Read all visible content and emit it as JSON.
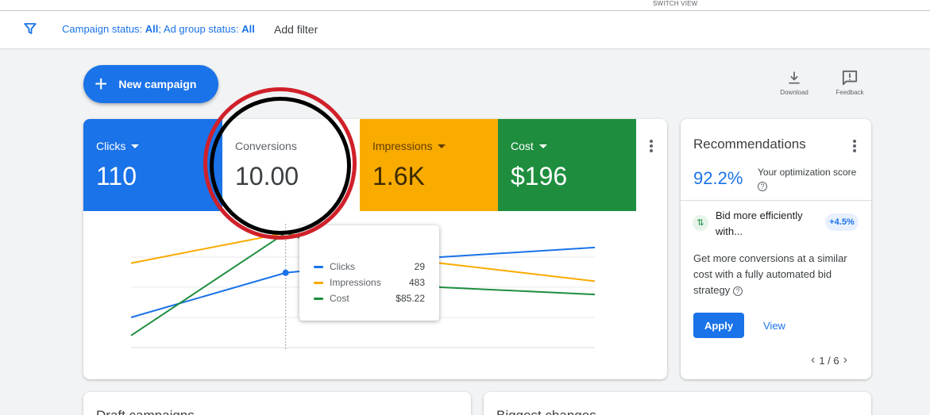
{
  "header": {
    "switch_view": "SWITCH VIEW"
  },
  "filterbar": {
    "campaign_status_label": "Campaign status: ",
    "campaign_status_value": "All",
    "sep": "; ",
    "ad_group_status_label": "Ad group status: ",
    "ad_group_status_value": "All",
    "add_filter": "Add filter"
  },
  "actions": {
    "new_campaign": "New campaign",
    "download": "Download",
    "feedback": "Feedback"
  },
  "metrics": [
    {
      "label": "Clicks",
      "value": "110",
      "color": "#1a73e8"
    },
    {
      "label": "Conversions",
      "value": "10.00",
      "color": "#ffffff"
    },
    {
      "label": "Impressions",
      "value": "1.6K",
      "color": "#f9ab00"
    },
    {
      "label": "Cost",
      "value": "$196",
      "color": "#1e8e3e"
    }
  ],
  "chart_data": {
    "type": "line",
    "x": [
      0,
      1,
      2,
      3
    ],
    "series": [
      {
        "name": "Clicks",
        "color": "#1a73e8",
        "values": [
          0.25,
          0.62,
          0.75,
          0.83
        ]
      },
      {
        "name": "Impressions",
        "color": "#f9ab00",
        "values": [
          0.7,
          0.95,
          0.7,
          0.55
        ]
      },
      {
        "name": "Cost",
        "color": "#1e8e3e",
        "values": [
          0.1,
          0.95,
          0.5,
          0.44
        ]
      }
    ],
    "hover_index": 1,
    "grid": true,
    "ylim": [
      0,
      1
    ]
  },
  "tooltip": {
    "rows": [
      {
        "name": "Clicks",
        "value": "29",
        "color": "#1a73e8"
      },
      {
        "name": "Impressions",
        "value": "483",
        "color": "#f9ab00"
      },
      {
        "name": "Cost",
        "value": "$85.22",
        "color": "#1e8e3e"
      }
    ]
  },
  "recommendations": {
    "title": "Recommendations",
    "score": "92.2%",
    "score_label": "Your optimization score",
    "item_title": "Bid more efficiently with...",
    "item_badge": "+4.5%",
    "item_desc": "Get more conversions at a similar cost with a fully automated bid strategy",
    "apply": "Apply",
    "view": "View",
    "pager": "1 / 6"
  },
  "bottom_cards": [
    {
      "title": "Draft campaigns"
    },
    {
      "title": "Biggest changes"
    }
  ]
}
